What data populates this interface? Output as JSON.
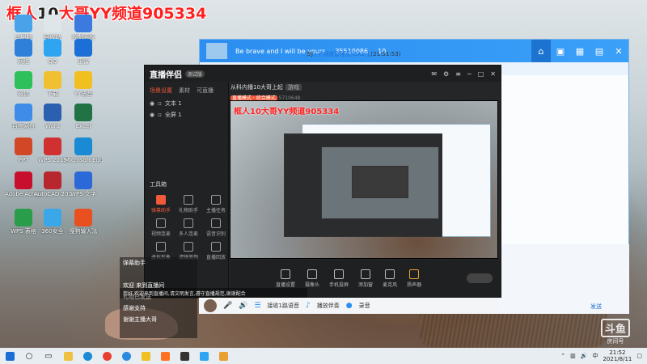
{
  "watermark": {
    "prefix": "框人",
    "highlight": "10",
    "suffix": "大哥YY频道905334"
  },
  "desktop_icons": [
    {
      "label": "此电脑",
      "color": "#4aa3e8"
    },
    {
      "label": "回收站",
      "color": "#dfe6ea"
    },
    {
      "label": "控制面板",
      "color": "#3b7be0"
    },
    {
      "label": "网络",
      "color": "#2f80d8"
    },
    {
      "label": "QQ",
      "color": "#2fa4f0"
    },
    {
      "label": "迅雷",
      "color": "#1c6fd6"
    },
    {
      "label": "微信",
      "color": "#2ec05a"
    },
    {
      "label": "下载",
      "color": "#f0c030"
    },
    {
      "label": "YY语音",
      "color": "#f0c020"
    },
    {
      "label": "百度网盘",
      "color": "#3e8ce8"
    },
    {
      "label": "Word",
      "color": "#2b5fb0"
    },
    {
      "label": "Excel",
      "color": "#217346"
    },
    {
      "label": "PPT",
      "color": "#d24726"
    },
    {
      "label": "WPS 2019",
      "color": "#d03030"
    },
    {
      "label": "Microsoft Edge",
      "color": "#1a8ad4"
    },
    {
      "label": "Adobe Acrobat",
      "color": "#c8102e"
    },
    {
      "label": "AutoCAD 2019",
      "color": "#b8262e"
    },
    {
      "label": "WPS 文字",
      "color": "#2b68d8"
    },
    {
      "label": "WPS 表格",
      "color": "#2a9d4b"
    },
    {
      "label": "360安全",
      "color": "#3aa8e8"
    },
    {
      "label": "搜狗输入法",
      "color": "#e85020"
    }
  ],
  "yy_window": {
    "channel_title": "Be brave and I will be yours",
    "channel_id": "35510086",
    "user_count": "10",
    "message_prefix": "的",
    "message_role": "[子频道管理员(CA1)]",
    "message_time": ",(21:51:53)",
    "send_label": "发送"
  },
  "broadcast_window": {
    "logo": "直播伴侣",
    "version": "测试版",
    "tabs": [
      "场景设置",
      "素材",
      "可直播"
    ],
    "sources": [
      "文本 1",
      "全屏 1"
    ],
    "tools_label": "工具箱",
    "tools": [
      "弹幕助手",
      "礼物助手",
      "主播任务",
      "视频连麦",
      "多人连麦",
      "语音识别",
      "虚拟形象",
      "滤镜美颜",
      "直播回放"
    ],
    "room_title": "从科内播10大哥上起",
    "room_tag": "游戏",
    "room_meta": "直播模式 · 综合模式",
    "room_count": "5710648",
    "bottom_buttons": [
      "直播设置",
      "摄像头",
      "手机投屏",
      "添加窗",
      "麦克风",
      "扬声器"
    ],
    "preview_watermark": "框人10大哥YY频道905334"
  },
  "chat": {
    "header": "弹幕助手",
    "lines": [
      "欢迎 来到直播间",
      "礼物已发送",
      "感谢支持",
      "谢谢主播大哥"
    ],
    "notice": "您好,欢迎来到直播间,请文明发言,遵守直播规范,谢谢配合"
  },
  "bottom_toolbar": {
    "items": [
      "麦克风",
      "音量",
      "接收1路语音",
      "播放伴奏",
      "录音"
    ]
  },
  "brand": {
    "name": "斗鱼",
    "sub": "房间号"
  },
  "taskbar": {
    "time": "21:52",
    "date": "2021/8/11",
    "language": "中",
    "apps": [
      "start",
      "search",
      "task-view",
      "explorer",
      "edge",
      "chrome",
      "ie",
      "yy",
      "douyu",
      "broadcast",
      "qq",
      "folder"
    ]
  }
}
